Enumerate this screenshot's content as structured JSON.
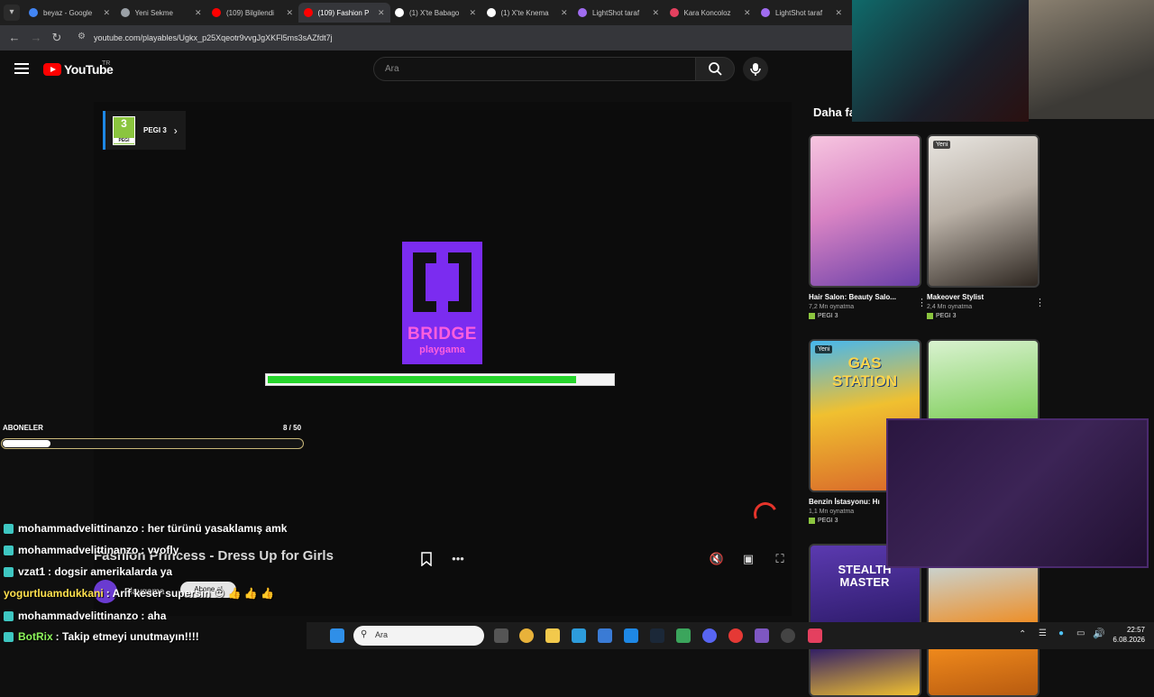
{
  "browser": {
    "tabs": [
      {
        "title": "beyaz - Google",
        "color": "#4285f4"
      },
      {
        "title": "Yeni Sekme",
        "color": "#9aa0a6"
      },
      {
        "title": "(109) Bilgilendi",
        "color": "#ff0000"
      },
      {
        "title": "(109) Fashion P",
        "color": "#ff0000",
        "active": true
      },
      {
        "title": "(1) X'te Babago",
        "color": "#ffffff"
      },
      {
        "title": "(1) X'te Knema",
        "color": "#ffffff"
      },
      {
        "title": "LightShot taraf",
        "color": "#a06cf0"
      },
      {
        "title": "Kara Koncoloz",
        "color": "#e4405f"
      },
      {
        "title": "LightShot taraf",
        "color": "#a06cf0"
      }
    ],
    "url": "youtube.com/playables/Ugkx_p25Xqeotr9vvgJgXKFl5ms3sAZfdt7j"
  },
  "header": {
    "logo_text": "YouTube",
    "country": "TR",
    "search_placeholder": "Ara"
  },
  "game": {
    "pegi_number": "3",
    "pegi_small": "PEGI",
    "pegi_label": "PEGI 3",
    "loader_word": "BRIDGE",
    "loader_sub": "playgama",
    "loading_progress": 0.89,
    "title": "Fashion Princess - Dress Up for Girls",
    "channel": "Playgama",
    "subscribe_label": "Abone ol"
  },
  "goal": {
    "label": "ABONELER",
    "count": "8 / 50",
    "current": 8,
    "target": 50
  },
  "recommendations": {
    "heading": "Daha fa",
    "items": [
      {
        "title": "Hair Salon: Beauty Salo...",
        "plays": "7,2 Mn oynatma",
        "pegi": "PEGI 3",
        "new": "",
        "thumb": "linear-gradient(160deg,#f7c6e0,#d984c4 45%,#6a3fa8)"
      },
      {
        "title": "Makeover Stylist",
        "plays": "2,4 Mn oynatma",
        "pegi": "PEGI 3",
        "new": "Yeni",
        "thumb": "linear-gradient(160deg,#e9e6e1,#b9b0a6 45%,#2d2620)"
      },
      {
        "title": "Benzin İstasyonu: Hı",
        "plays": "1,1 Mn oynatma",
        "pegi": "PEGI 3",
        "new": "Yeni",
        "thumb": "linear-gradient(170deg,#46b7ef,#f0c030 45%,#d9682a)"
      },
      {
        "title": "",
        "plays": "",
        "pegi": "",
        "new": "",
        "thumb": "linear-gradient(170deg,#d9f2d0,#8bd36a 50%,#3d8c2e)"
      },
      {
        "title": "",
        "plays": "",
        "pegi": "",
        "new": "",
        "thumb": "linear-gradient(170deg,#5b3ab0,#2c1a68 60%,#f0c030)"
      },
      {
        "title": "",
        "plays": "",
        "pegi": "",
        "new": "",
        "thumb": "linear-gradient(170deg,#bfe6ff,#f08a1c 60%,#b85b10)"
      }
    ]
  },
  "game_thumb_texts": {
    "gas_station": "GAS STATION",
    "stealth_master": "STEALTH MASTER"
  },
  "chat": [
    {
      "user": "mohammadvelittinanzo",
      "message": ": her türünü yasaklamış amk",
      "icon": true,
      "color": "white"
    },
    {
      "user": "mohammadvelittinanzo",
      "message": ": vvofly",
      "icon": true,
      "color": "white"
    },
    {
      "user": "vzat1",
      "message": ": dogsir amerikalarda ya",
      "icon": true,
      "color": "white"
    },
    {
      "user": "yogurtluamdukkani",
      "message": ": Arif keser supersin 😍 👍 👍 👍",
      "icon": false,
      "color": "gold"
    },
    {
      "user": "mohammadvelittinanzo",
      "message": ": aha",
      "icon": true,
      "color": "white"
    },
    {
      "user": "BotRix",
      "message": ": Takip etmeyi unutmayın!!!!",
      "icon": true,
      "color": "green"
    }
  ],
  "taskbar": {
    "search_placeholder": "Ara",
    "time": "22:57",
    "date": "6.08.2026"
  }
}
